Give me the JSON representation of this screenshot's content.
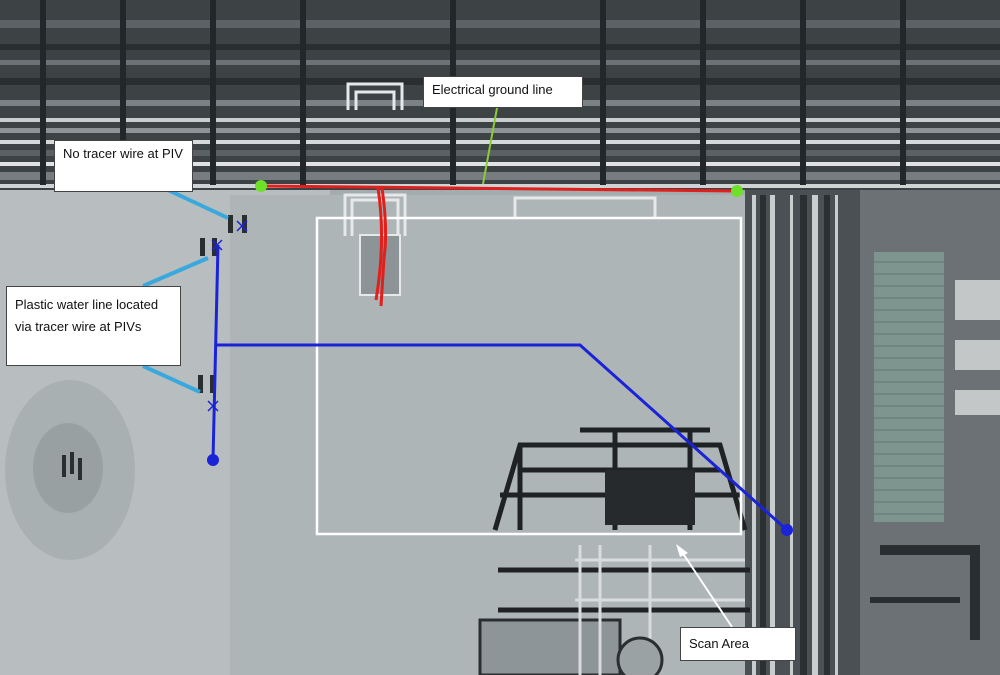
{
  "callouts": {
    "electrical_ground_line": "Electrical ground line",
    "no_tracer_wire": "No tracer wire at PIV",
    "plastic_water_line": "Plastic water line located via tracer wire at PIVs",
    "scan_area": "Scan Area"
  },
  "colors": {
    "electrical_line": "#e0201c",
    "water_line": "#1a23d8",
    "scan_area_border": "#ffffff",
    "endpoint_marker": "#6ee02a",
    "leader_cyan": "#3aa8dc",
    "leader_green": "#8ccc3a"
  },
  "icons": [
    "piv-valve-icon",
    "endpoint-dot-icon"
  ]
}
